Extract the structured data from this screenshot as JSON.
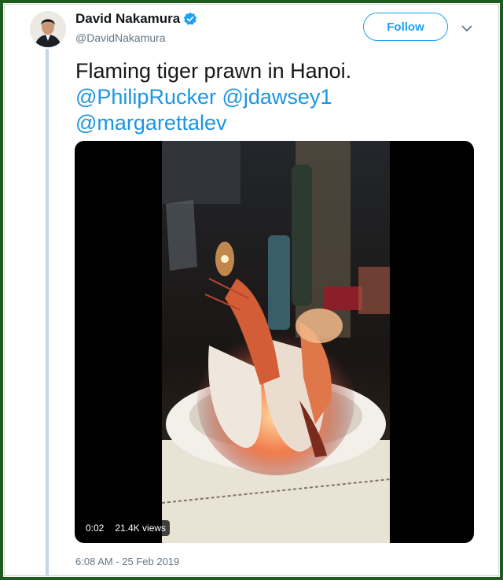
{
  "user": {
    "display_name": "David Nakamura",
    "handle": "@DavidNakamura",
    "verified": true
  },
  "actions": {
    "follow_label": "Follow",
    "more_icon": "chevron-down-icon"
  },
  "tweet": {
    "text_line": "Flaming tiger prawn in Hanoi.",
    "mentions": [
      "@PhilipRucker",
      "@jdawsey1",
      "@margarettalev"
    ],
    "timestamp": "6:08 AM - 25 Feb 2019"
  },
  "video": {
    "elapsed": "0:02",
    "views": "21.4K views"
  },
  "colors": {
    "accent": "#1da1f2",
    "mention": "#1b95e0",
    "secondary_text": "#657786",
    "frame": "#1f5a1f"
  }
}
